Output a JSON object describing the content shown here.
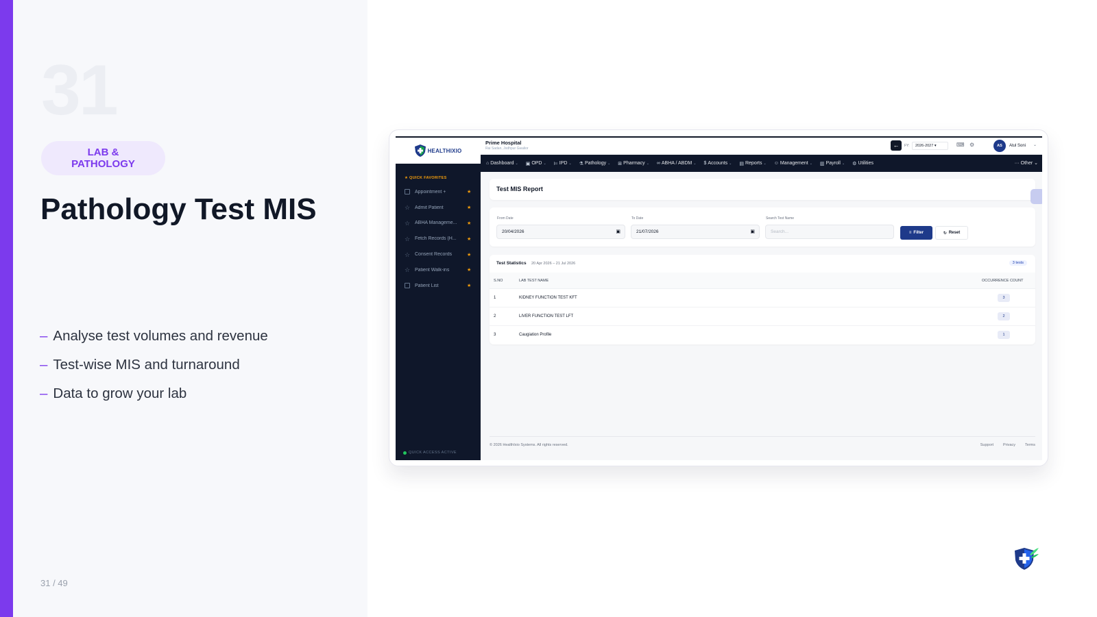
{
  "slide": {
    "number": "31",
    "category": "LAB & PATHOLOGY",
    "title": "Pathology Test MIS",
    "bullets": [
      "Analyse test volumes and revenue",
      "Test-wise MIS and turnaround",
      "Data to grow your lab"
    ],
    "bullet_marker": "–",
    "page_counter": "31 / 49",
    "accent_color": "#7c3aed"
  },
  "app": {
    "brand": "HEALTHIXIO",
    "hospital_name": "Prime Hospital",
    "hospital_location": "Rai Sadan, Jodhpur Gwalior",
    "fy_label": "FY:",
    "fy_value": "2026-2027",
    "user_initials": "AS",
    "user_name": "Atul Soni",
    "nav": [
      {
        "label": "Dashboard",
        "icon": "home-icon"
      },
      {
        "label": "OPD",
        "icon": "calendar-icon"
      },
      {
        "label": "IPD",
        "icon": "bed-icon"
      },
      {
        "label": "Pathology",
        "icon": "flask-icon"
      },
      {
        "label": "Pharmacy",
        "icon": "pharmacy-icon"
      },
      {
        "label": "ABHA / ABDM",
        "icon": "link-icon"
      },
      {
        "label": "Accounts",
        "icon": "dollar-icon"
      },
      {
        "label": "Reports",
        "icon": "report-icon"
      },
      {
        "label": "Management",
        "icon": "users-icon"
      },
      {
        "label": "Payroll",
        "icon": "payroll-icon"
      },
      {
        "label": "Utilities",
        "icon": "gear-icon"
      }
    ],
    "nav_other": "··· Other",
    "sidebar": {
      "heading": "★ QUICK FAVORITES",
      "items": [
        {
          "label": "Appointment +",
          "icon": "calendar-icon"
        },
        {
          "label": "Admit Patient",
          "icon": "star-icon"
        },
        {
          "label": "ABHA Manageme...",
          "icon": "star-icon"
        },
        {
          "label": "Fetch Records (H...",
          "icon": "star-icon"
        },
        {
          "label": "Consent Records",
          "icon": "star-icon"
        },
        {
          "label": "Patient Walk-ins",
          "icon": "star-icon"
        },
        {
          "label": "Patient List",
          "icon": "document-icon"
        }
      ],
      "quick_access": "QUICK ACCESS ACTIVE"
    },
    "report": {
      "title": "Test MIS Report",
      "from_label": "From Date",
      "from_value": "20/04/2026",
      "to_label": "To Date",
      "to_value": "21/07/2026",
      "search_label": "Search Test Name",
      "search_placeholder": "Search...",
      "filter_btn": "Filter",
      "reset_btn": "Reset"
    },
    "stats": {
      "title": "Test Statistics",
      "range": "20 Apr 2026 – 21 Jul 2026",
      "badge": "3 tests",
      "columns": [
        "S.NO",
        "LAB TEST NAME",
        "OCCURRENCE COUNT"
      ],
      "rows": [
        {
          "sno": "1",
          "name": "KIDNEY FUNCTION TEST KFT",
          "count": "3"
        },
        {
          "sno": "2",
          "name": "LIVER FUNCTION TEST LFT",
          "count": "2"
        },
        {
          "sno": "3",
          "name": "Caugiation Profile",
          "count": "1"
        }
      ]
    },
    "footer": {
      "copyright": "© 2026 HealthIxio Systems. All rights reserved.",
      "links": [
        "Support",
        "Privacy",
        "Terms"
      ]
    }
  }
}
